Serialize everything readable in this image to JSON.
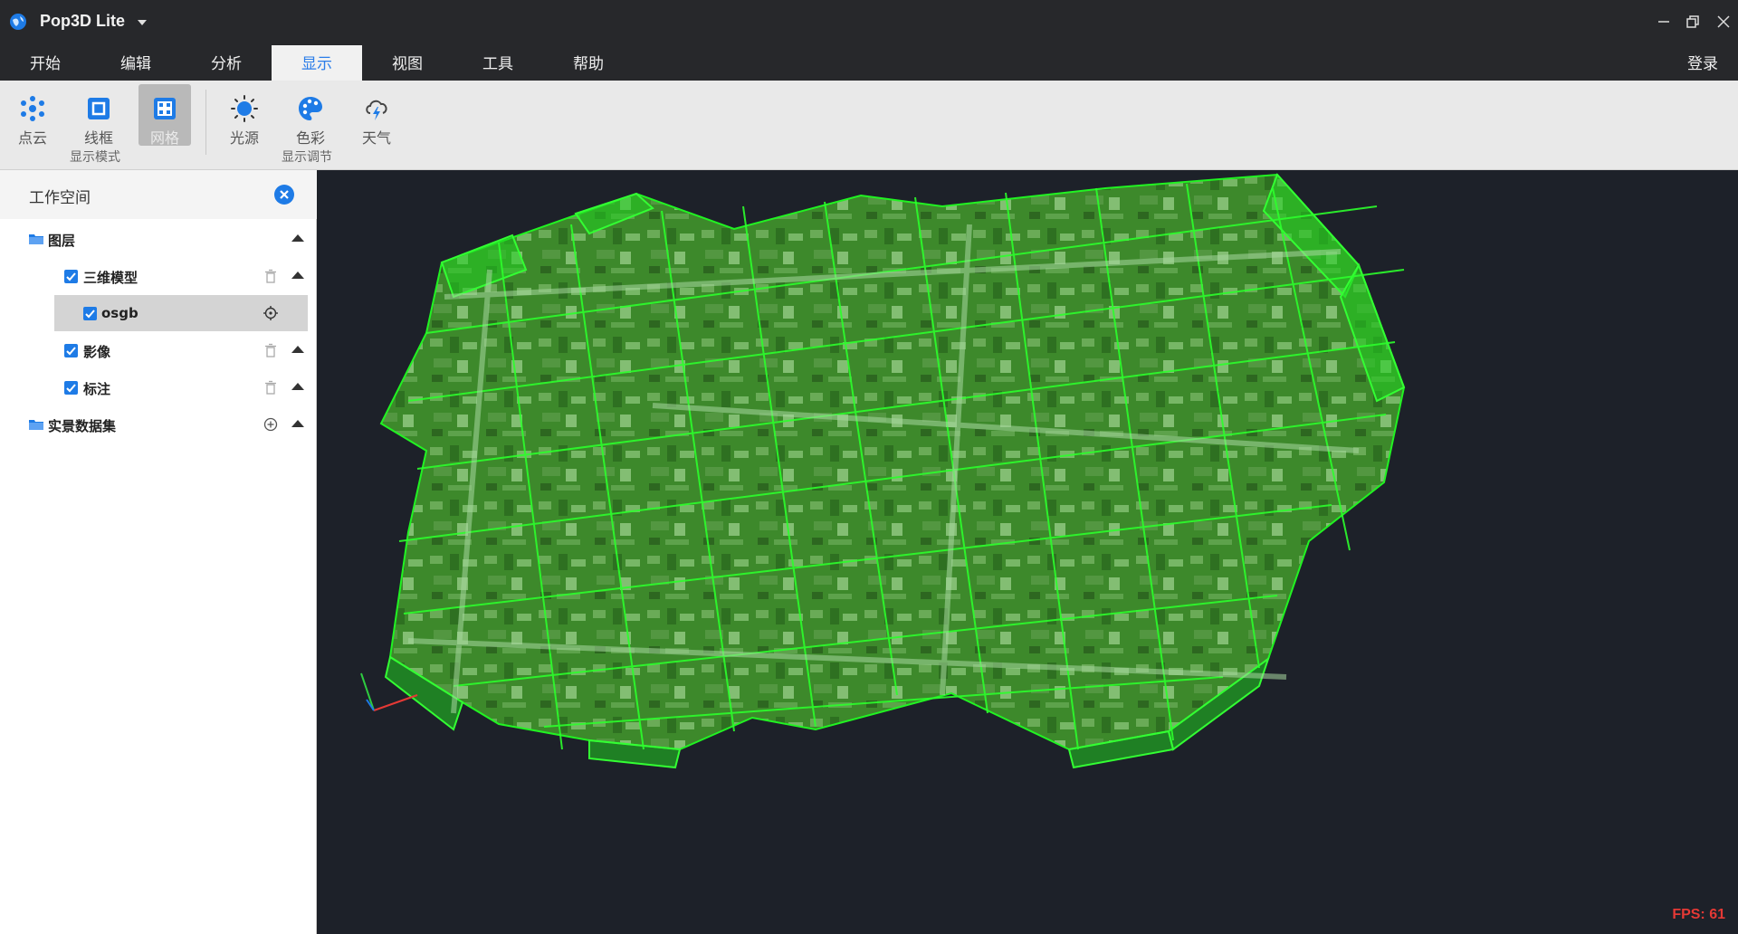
{
  "app": {
    "title": "Pop3D Lite"
  },
  "menu": {
    "items": [
      {
        "label": "开始"
      },
      {
        "label": "编辑"
      },
      {
        "label": "分析"
      },
      {
        "label": "显示"
      },
      {
        "label": "视图"
      },
      {
        "label": "工具"
      },
      {
        "label": "帮助"
      }
    ],
    "active": "显示",
    "login": "登录"
  },
  "ribbon": {
    "display_mode": {
      "label": "显示模式",
      "buttons": [
        {
          "label": "点云",
          "icon": "point-cloud-icon"
        },
        {
          "label": "线框",
          "icon": "wireframe-icon"
        },
        {
          "label": "网格",
          "icon": "mesh-grid-icon",
          "active": true
        }
      ]
    },
    "display_adjust": {
      "label": "显示调节",
      "buttons": [
        {
          "label": "光源",
          "icon": "sun-icon"
        },
        {
          "label": "色彩",
          "icon": "palette-icon"
        },
        {
          "label": "天气",
          "icon": "weather-icon"
        }
      ]
    }
  },
  "workspace": {
    "title": "工作空间",
    "tree": [
      {
        "label": "图层",
        "type": "folder"
      },
      {
        "label": "三维模型",
        "type": "layer",
        "checked": true
      },
      {
        "label": "osgb",
        "type": "layer",
        "checked": true,
        "selected": true
      },
      {
        "label": "影像",
        "type": "layer",
        "checked": true
      },
      {
        "label": "标注",
        "type": "layer",
        "checked": true
      },
      {
        "label": "实景数据集",
        "type": "folder"
      }
    ]
  },
  "viewport": {
    "fps": "FPS: 61"
  },
  "colors": {
    "accent": "#1e7be6",
    "tile_outline": "#22ff22",
    "fps": "#e53935"
  }
}
